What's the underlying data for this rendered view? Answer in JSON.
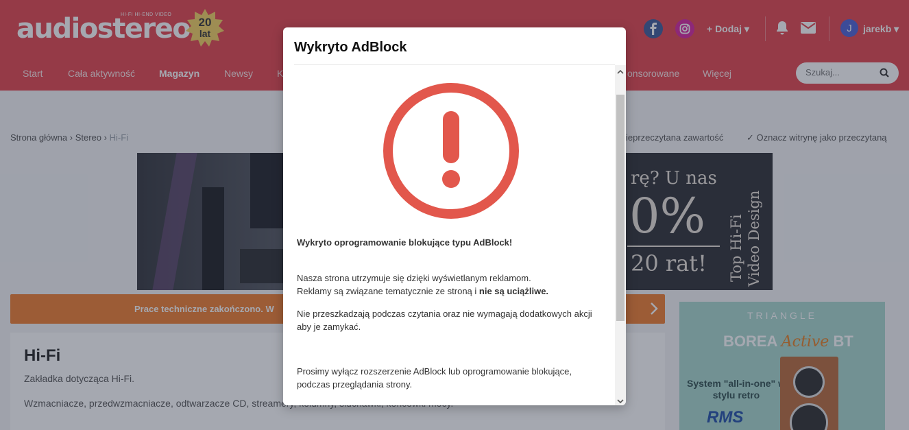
{
  "header": {
    "logo_text": "audiostereo",
    "logo_tagline": "HI-FI  HI-END  VIDEO",
    "badge_number": "20",
    "badge_label": "lat",
    "add_label": "+ Dodaj",
    "username": "jarekb",
    "avatar_letter": "J"
  },
  "nav": {
    "items": [
      "Start",
      "Cała aktywność",
      "Magazyn",
      "Newsy",
      "K",
      "onsorowane",
      "Więcej"
    ],
    "active_index": 2,
    "search_placeholder": "Szukaj..."
  },
  "breadcrumb": {
    "items": [
      "Strona główna",
      "Stereo",
      "Hi-Fi"
    ],
    "mark_unread": "ieprzeczytana zawartość",
    "mark_site_read": "Oznacz witrynę jako przeczytaną"
  },
  "banner": {
    "question": "rę? U nas",
    "percent": "0%",
    "installments": "20 rat!",
    "vertical_line1": "Top Hi-Fi",
    "vertical_line2": "Video Design"
  },
  "notice": {
    "text": "Prace techniczne zakończono. W"
  },
  "card": {
    "title": "Hi-Fi",
    "subtitle": "Zakładka dotycząca Hi-Fi.",
    "description": "Wzmacniacze, przedwzmacniacze, odtwarzacze CD, streamery, kolumny, słuchawki, końcówki mocy."
  },
  "side_ad": {
    "brand": "TRIANGLE",
    "model_pre": "BOREA",
    "model_active": "Active",
    "model_post": "BT",
    "tagline": "System \"all-in-one\" w stylu retro",
    "shop": "RMS"
  },
  "modal": {
    "title": "Wykryto AdBlock",
    "heading": "Wykryto oprogramowanie blokujące typu AdBlock!",
    "p1_line1": "Nasza strona utrzymuje się dzięki wyświetlanym reklamom.",
    "p1_line2_pre": "Reklamy są związane tematycznie ze stroną i ",
    "p1_line2_bold": "nie są uciążliwe.",
    "p2": "Nie przeszkadzają podczas czytania oraz nie wymagają dodatkowych akcji aby je zamykać.",
    "p3": "Prosimy wyłącz rozszerzenie AdBlock lub oprogramowanie blokujące, podczas przeglądania strony."
  },
  "colors": {
    "brand_red": "#e3424b",
    "alert_red": "#e2574c",
    "notice_orange": "#ef7c2e",
    "overlay": "rgba(40,48,66,0.42)"
  },
  "icons": [
    "facebook-icon",
    "instagram-icon",
    "bell-icon",
    "mail-icon",
    "search-icon",
    "alert-circle-icon",
    "chevron-right-icon",
    "scroll-up-icon",
    "scroll-down-icon"
  ]
}
